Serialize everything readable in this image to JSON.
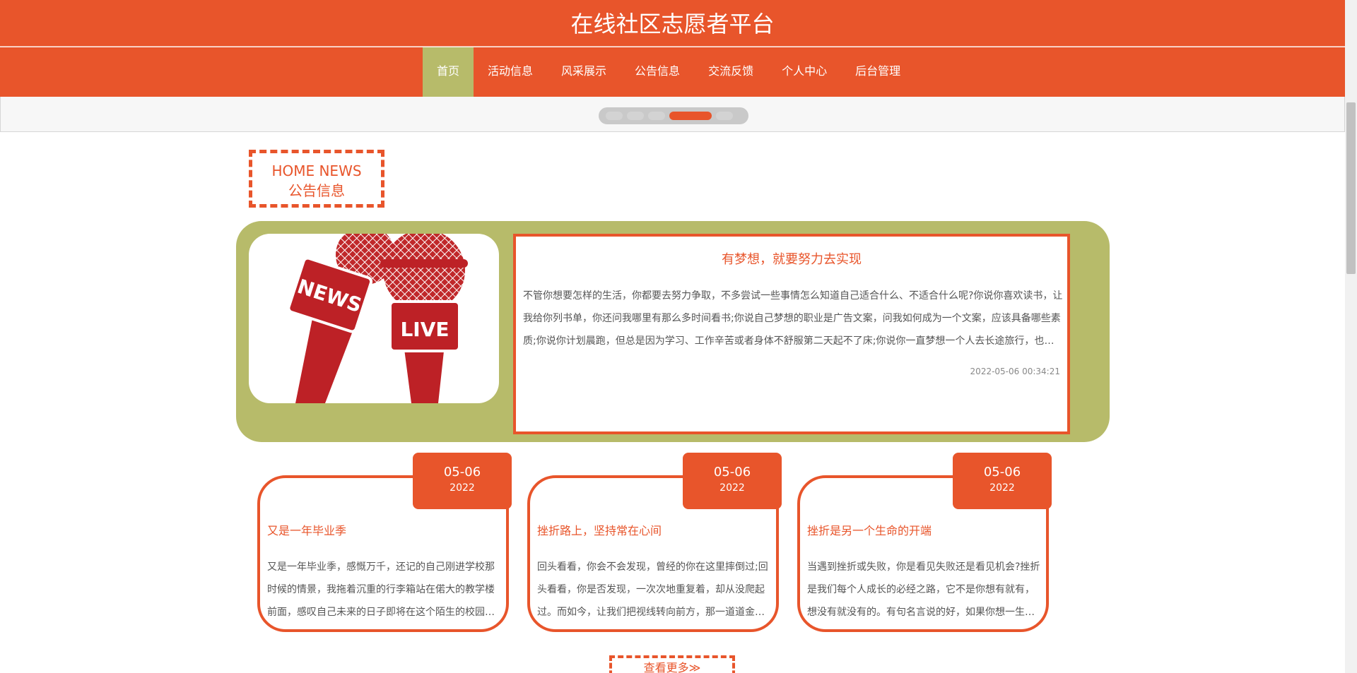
{
  "header": {
    "title": "在线社区志愿者平台"
  },
  "nav": {
    "items": [
      {
        "label": "首页",
        "active": true
      },
      {
        "label": "活动信息",
        "active": false
      },
      {
        "label": "风采展示",
        "active": false
      },
      {
        "label": "公告信息",
        "active": false
      },
      {
        "label": "交流反馈",
        "active": false
      },
      {
        "label": "个人中心",
        "active": false
      },
      {
        "label": "后台管理",
        "active": false
      }
    ]
  },
  "carousel": {
    "slide_count": 5,
    "active_index": 3
  },
  "section": {
    "title_en": "HOME NEWS",
    "title_cn": "公告信息"
  },
  "featured": {
    "image_text": {
      "news": "NEWS",
      "live": "LIVE"
    },
    "title": "有梦想，就要努力去实现",
    "text": "不管你想要怎样的生活，你都要去努力争取，不多尝试一些事情怎么知道自己适合什么、不适合什么呢?你说你喜欢读书，让我给你列书单，你还问我哪里有那么多时间看书;你说自己梦想的职业是广告文案，问我如何成为一个文案，应该具备哪些素质;你说你计划晨跑，但总是因为学习、工作辛苦或者身体不舒服第二天起不了床;你说你一直梦想一个人去长途旅行，也说你没有钱",
    "date": "2022-05-06 00:34:21"
  },
  "cards": [
    {
      "day": "05-06",
      "year": "2022",
      "title": "又是一年毕业季",
      "text": "又是一年毕业季，感慨万千，还记的自己刚进学校那时候的情景，我拖着沉重的行李箱站在偌大的教学楼前面，感叹自己未来的日子即将在这个陌生的校园里度过"
    },
    {
      "day": "05-06",
      "year": "2022",
      "title": "挫折路上，坚持常在心间",
      "text": "回头看看，你会不会发现，曾经的你在这里摔倒过;回头看看，你是否发现，一次次地重复着，却从没爬起过。而如今，让我们把视线转向前方，那一道道金色的阳光"
    },
    {
      "day": "05-06",
      "year": "2022",
      "title": "挫折是另一个生命的开端",
      "text": "当遇到挫折或失败，你是看见失败还是看见机会?挫折是我们每个人成长的必经之路，它不是你想有就有，想没有就没有的。有句名言说的好，如果你想一生摆脱苦难"
    }
  ],
  "more": {
    "label": "查看更多≫"
  },
  "colors": {
    "primary": "#e8552b",
    "olive": "#b7bb6a"
  }
}
